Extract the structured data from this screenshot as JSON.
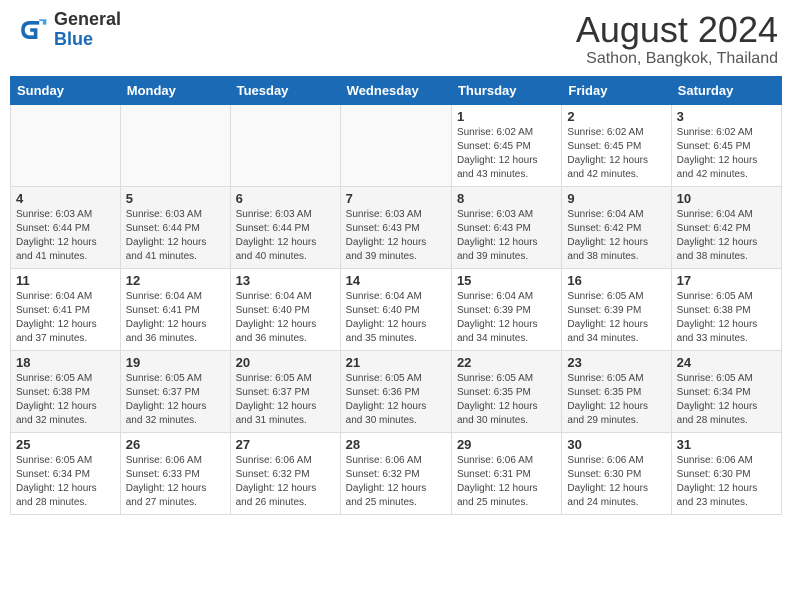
{
  "header": {
    "logo_general": "General",
    "logo_blue": "Blue",
    "month_year": "August 2024",
    "location": "Sathon, Bangkok, Thailand"
  },
  "weekdays": [
    "Sunday",
    "Monday",
    "Tuesday",
    "Wednesday",
    "Thursday",
    "Friday",
    "Saturday"
  ],
  "weeks": [
    [
      {
        "day": "",
        "info": ""
      },
      {
        "day": "",
        "info": ""
      },
      {
        "day": "",
        "info": ""
      },
      {
        "day": "",
        "info": ""
      },
      {
        "day": "1",
        "info": "Sunrise: 6:02 AM\nSunset: 6:45 PM\nDaylight: 12 hours\nand 43 minutes."
      },
      {
        "day": "2",
        "info": "Sunrise: 6:02 AM\nSunset: 6:45 PM\nDaylight: 12 hours\nand 42 minutes."
      },
      {
        "day": "3",
        "info": "Sunrise: 6:02 AM\nSunset: 6:45 PM\nDaylight: 12 hours\nand 42 minutes."
      }
    ],
    [
      {
        "day": "4",
        "info": "Sunrise: 6:03 AM\nSunset: 6:44 PM\nDaylight: 12 hours\nand 41 minutes."
      },
      {
        "day": "5",
        "info": "Sunrise: 6:03 AM\nSunset: 6:44 PM\nDaylight: 12 hours\nand 41 minutes."
      },
      {
        "day": "6",
        "info": "Sunrise: 6:03 AM\nSunset: 6:44 PM\nDaylight: 12 hours\nand 40 minutes."
      },
      {
        "day": "7",
        "info": "Sunrise: 6:03 AM\nSunset: 6:43 PM\nDaylight: 12 hours\nand 39 minutes."
      },
      {
        "day": "8",
        "info": "Sunrise: 6:03 AM\nSunset: 6:43 PM\nDaylight: 12 hours\nand 39 minutes."
      },
      {
        "day": "9",
        "info": "Sunrise: 6:04 AM\nSunset: 6:42 PM\nDaylight: 12 hours\nand 38 minutes."
      },
      {
        "day": "10",
        "info": "Sunrise: 6:04 AM\nSunset: 6:42 PM\nDaylight: 12 hours\nand 38 minutes."
      }
    ],
    [
      {
        "day": "11",
        "info": "Sunrise: 6:04 AM\nSunset: 6:41 PM\nDaylight: 12 hours\nand 37 minutes."
      },
      {
        "day": "12",
        "info": "Sunrise: 6:04 AM\nSunset: 6:41 PM\nDaylight: 12 hours\nand 36 minutes."
      },
      {
        "day": "13",
        "info": "Sunrise: 6:04 AM\nSunset: 6:40 PM\nDaylight: 12 hours\nand 36 minutes."
      },
      {
        "day": "14",
        "info": "Sunrise: 6:04 AM\nSunset: 6:40 PM\nDaylight: 12 hours\nand 35 minutes."
      },
      {
        "day": "15",
        "info": "Sunrise: 6:04 AM\nSunset: 6:39 PM\nDaylight: 12 hours\nand 34 minutes."
      },
      {
        "day": "16",
        "info": "Sunrise: 6:05 AM\nSunset: 6:39 PM\nDaylight: 12 hours\nand 34 minutes."
      },
      {
        "day": "17",
        "info": "Sunrise: 6:05 AM\nSunset: 6:38 PM\nDaylight: 12 hours\nand 33 minutes."
      }
    ],
    [
      {
        "day": "18",
        "info": "Sunrise: 6:05 AM\nSunset: 6:38 PM\nDaylight: 12 hours\nand 32 minutes."
      },
      {
        "day": "19",
        "info": "Sunrise: 6:05 AM\nSunset: 6:37 PM\nDaylight: 12 hours\nand 32 minutes."
      },
      {
        "day": "20",
        "info": "Sunrise: 6:05 AM\nSunset: 6:37 PM\nDaylight: 12 hours\nand 31 minutes."
      },
      {
        "day": "21",
        "info": "Sunrise: 6:05 AM\nSunset: 6:36 PM\nDaylight: 12 hours\nand 30 minutes."
      },
      {
        "day": "22",
        "info": "Sunrise: 6:05 AM\nSunset: 6:35 PM\nDaylight: 12 hours\nand 30 minutes."
      },
      {
        "day": "23",
        "info": "Sunrise: 6:05 AM\nSunset: 6:35 PM\nDaylight: 12 hours\nand 29 minutes."
      },
      {
        "day": "24",
        "info": "Sunrise: 6:05 AM\nSunset: 6:34 PM\nDaylight: 12 hours\nand 28 minutes."
      }
    ],
    [
      {
        "day": "25",
        "info": "Sunrise: 6:05 AM\nSunset: 6:34 PM\nDaylight: 12 hours\nand 28 minutes."
      },
      {
        "day": "26",
        "info": "Sunrise: 6:06 AM\nSunset: 6:33 PM\nDaylight: 12 hours\nand 27 minutes."
      },
      {
        "day": "27",
        "info": "Sunrise: 6:06 AM\nSunset: 6:32 PM\nDaylight: 12 hours\nand 26 minutes."
      },
      {
        "day": "28",
        "info": "Sunrise: 6:06 AM\nSunset: 6:32 PM\nDaylight: 12 hours\nand 25 minutes."
      },
      {
        "day": "29",
        "info": "Sunrise: 6:06 AM\nSunset: 6:31 PM\nDaylight: 12 hours\nand 25 minutes."
      },
      {
        "day": "30",
        "info": "Sunrise: 6:06 AM\nSunset: 6:30 PM\nDaylight: 12 hours\nand 24 minutes."
      },
      {
        "day": "31",
        "info": "Sunrise: 6:06 AM\nSunset: 6:30 PM\nDaylight: 12 hours\nand 23 minutes."
      }
    ]
  ]
}
